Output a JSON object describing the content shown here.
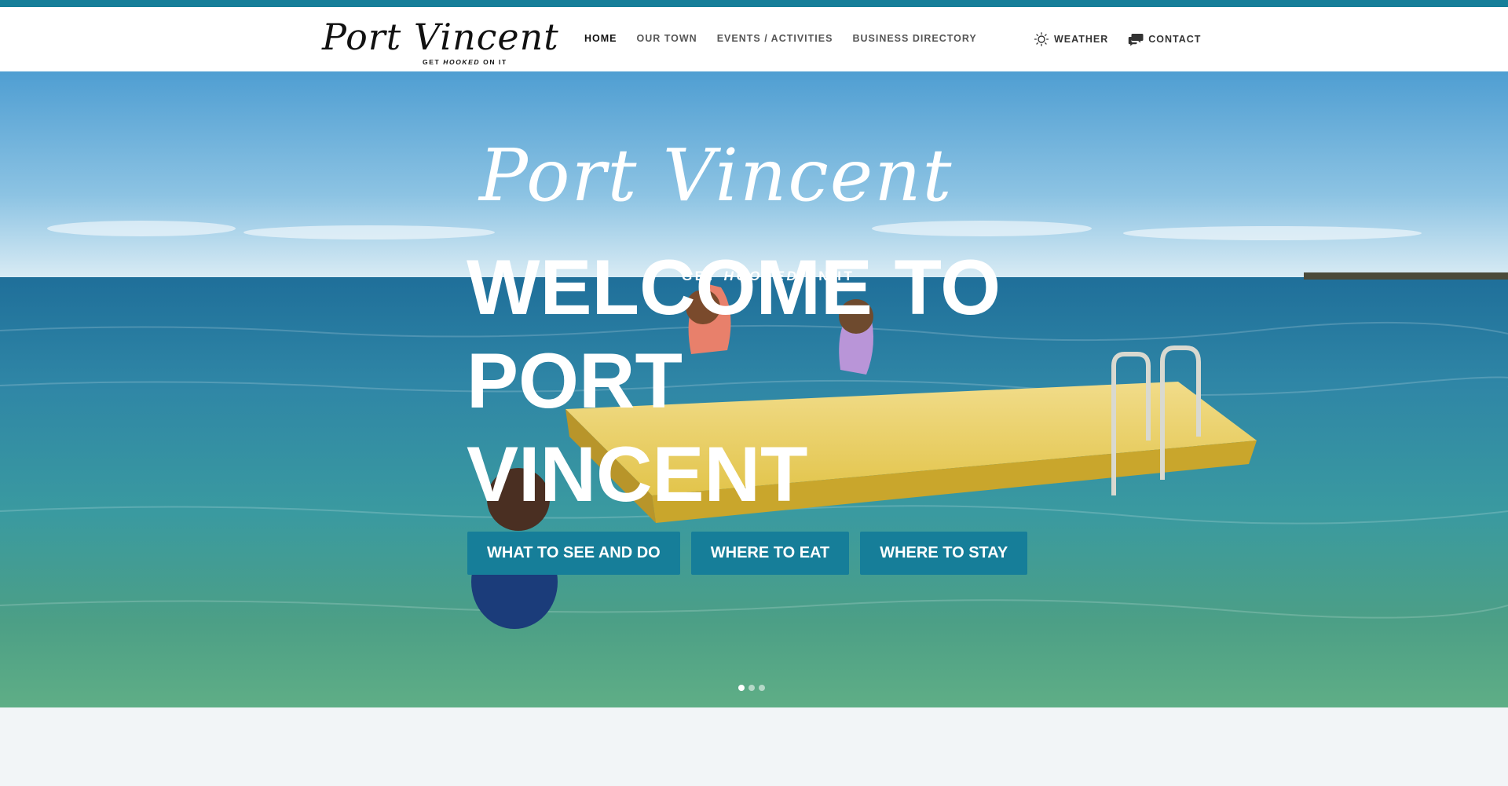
{
  "colors": {
    "accent": "#167e99",
    "header_bg": "#ffffff",
    "page_bg": "#f2f5f7",
    "nav_text": "#555555",
    "nav_active": "#111111"
  },
  "header": {
    "logo": {
      "script": "Port Vincent",
      "tag_pre": "GET ",
      "tag_em": "HOOKED",
      "tag_post": " ON IT"
    },
    "nav": [
      {
        "label": "HOME",
        "active": true
      },
      {
        "label": "OUR TOWN",
        "active": false
      },
      {
        "label": "EVENTS / ACTIVITIES",
        "active": false
      },
      {
        "label": "BUSINESS DIRECTORY",
        "active": false
      }
    ],
    "utility": [
      {
        "label": "WEATHER",
        "icon": "sun-icon"
      },
      {
        "label": "CONTACT",
        "icon": "chat-bubbles-icon"
      }
    ]
  },
  "hero": {
    "logo": {
      "script": "Port Vincent",
      "tag_pre": "GET ",
      "tag_em": "HOOKED",
      "tag_post": " ON IT"
    },
    "headline_lines": [
      "WELCOME TO",
      "PORT",
      "VINCENT"
    ],
    "buttons": [
      {
        "label": "WHAT TO SEE AND DO"
      },
      {
        "label": "WHERE TO EAT"
      },
      {
        "label": "WHERE TO STAY"
      }
    ],
    "slider": {
      "count": 3,
      "active_index": 0
    }
  }
}
